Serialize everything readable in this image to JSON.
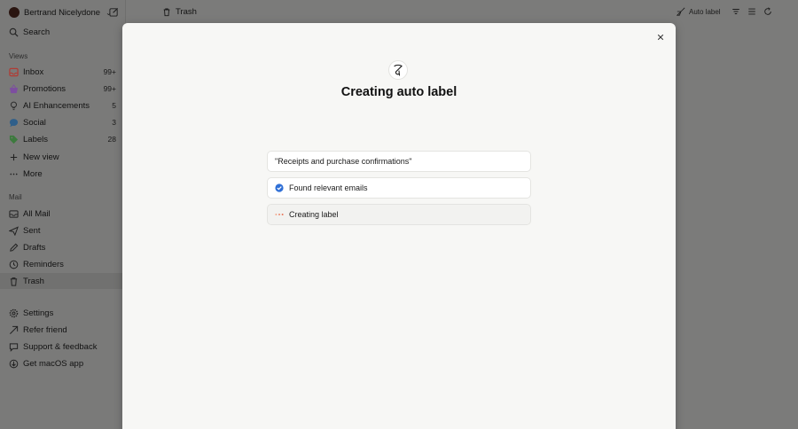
{
  "sidebar": {
    "account_name": "Bertrand Nicelydone",
    "views_label": "Views",
    "mail_label": "Mail",
    "search_label": "Search",
    "views": [
      {
        "label": "Inbox",
        "count": "99+",
        "icon": "inbox-icon"
      },
      {
        "label": "Promotions",
        "count": "99+",
        "icon": "basket-icon"
      },
      {
        "label": "AI Enhancements",
        "count": "5",
        "icon": "lightbulb-icon"
      },
      {
        "label": "Social",
        "count": "3",
        "icon": "chat-bubble-icon"
      },
      {
        "label": "Labels",
        "count": "28",
        "icon": "tag-icon"
      },
      {
        "label": "New view",
        "count": "",
        "icon": "plus-icon"
      },
      {
        "label": "More",
        "count": "",
        "icon": "ellipsis-icon"
      }
    ],
    "mail": [
      {
        "label": "All Mail",
        "icon": "all-mail-icon"
      },
      {
        "label": "Sent",
        "icon": "send-icon"
      },
      {
        "label": "Drafts",
        "icon": "draft-icon"
      },
      {
        "label": "Reminders",
        "icon": "clock-icon"
      },
      {
        "label": "Trash",
        "icon": "trash-icon"
      }
    ],
    "footer": [
      {
        "label": "Settings",
        "icon": "gear-icon"
      },
      {
        "label": "Refer friend",
        "icon": "refer-icon"
      },
      {
        "label": "Support & feedback",
        "icon": "chat-icon"
      },
      {
        "label": "Get macOS app",
        "icon": "download-icon"
      }
    ]
  },
  "header": {
    "title": "Trash",
    "auto_label_button": "Auto label"
  },
  "modal": {
    "title": "Creating auto label",
    "steps": [
      {
        "text": "\"Receipts and purchase confirmations\"",
        "status": "none"
      },
      {
        "text": "Found relevant emails",
        "status": "done"
      },
      {
        "text": "Creating label",
        "status": "loading"
      }
    ],
    "colors": {
      "check": "#2f6fd6",
      "loading_dots": "#e8765a"
    }
  }
}
